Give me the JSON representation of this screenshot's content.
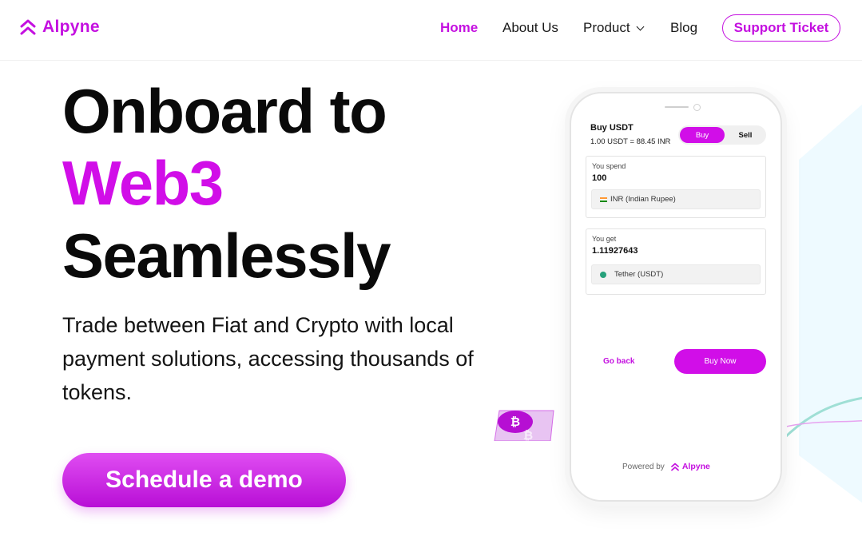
{
  "colors": {
    "brand": "#c410e0",
    "heading": "#0a0a0a",
    "accent": "#d10ee8"
  },
  "nav": {
    "logo_text": "Alpyne",
    "links": {
      "home": "Home",
      "about": "About Us",
      "product": "Product",
      "blog": "Blog"
    },
    "support_label": "Support Ticket"
  },
  "hero": {
    "line1": "Onboard to",
    "line2": "Web3",
    "line3": "Seamlessly",
    "subtitle": "Trade between Fiat and Crypto with local payment solutions, accessing thousands of tokens.",
    "cta_label": "Schedule a demo"
  },
  "widget": {
    "title": "Buy USDT",
    "rate": "1.00 USDT = 88.45 INR",
    "toggle": {
      "buy": "Buy",
      "sell": "Sell"
    },
    "spend": {
      "label": "You spend",
      "value": "100",
      "currency": "INR (Indian Rupee)"
    },
    "get": {
      "label": "You get",
      "value": "1.11927643",
      "currency": "Tether (USDT)"
    },
    "go_back": "Go back",
    "buy_now": "Buy Now",
    "powered_by": "Powered by",
    "brand": "Alpyne"
  },
  "icons": {
    "logo": "alpyne-chevrons-icon",
    "dropdown": "chevron-down-icon",
    "coin": "bitcoin-icon",
    "flag": "india-flag-icon",
    "token": "tether-icon"
  }
}
